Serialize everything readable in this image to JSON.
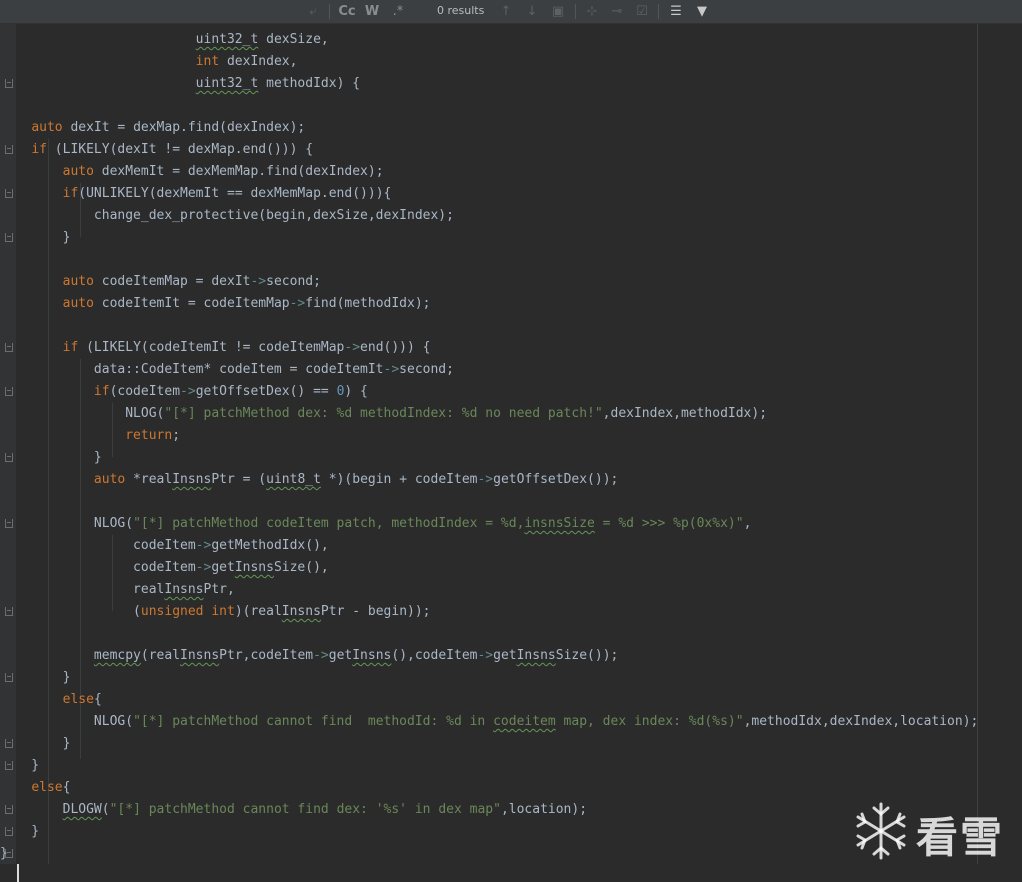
{
  "find_bar": {
    "results_label": "0 results",
    "match_case_label": "Cc",
    "words_label": "W",
    "regex_label": ".*"
  },
  "code_lines": [
    [
      {
        "t": "                         "
      },
      {
        "t": "uint32_t",
        "c": "uw"
      },
      {
        "t": " dexSize,"
      }
    ],
    [
      {
        "t": "                         "
      },
      {
        "t": "int",
        "c": "kw"
      },
      {
        "t": " dexIndex,"
      }
    ],
    [
      {
        "t": "                         "
      },
      {
        "t": "uint32_t",
        "c": "uw"
      },
      {
        "t": " methodIdx) {"
      }
    ],
    [],
    [
      {
        "t": "    "
      },
      {
        "t": "auto",
        "c": "kw"
      },
      {
        "t": " dexIt = dexMap.find(dexIndex);"
      }
    ],
    [
      {
        "t": "    "
      },
      {
        "t": "if",
        "c": "kw"
      },
      {
        "t": " (LIKELY(dexIt != dexMap.end())) {"
      }
    ],
    [
      {
        "t": "        "
      },
      {
        "t": "auto",
        "c": "kw"
      },
      {
        "t": " dexMemIt = dexMemMap.find(dexIndex);"
      }
    ],
    [
      {
        "t": "        "
      },
      {
        "t": "if",
        "c": "kw"
      },
      {
        "t": "(UNLIKELY(dexMemIt == dexMemMap.end())){"
      }
    ],
    [
      {
        "t": "            change_dex_protective(begin,dexSize,dexIndex);"
      }
    ],
    [
      {
        "t": "        }"
      }
    ],
    [],
    [
      {
        "t": "        "
      },
      {
        "t": "auto",
        "c": "kw"
      },
      {
        "t": " codeItemMap = dexIt"
      },
      {
        "t": "->",
        "c": "arr"
      },
      {
        "t": "second;"
      }
    ],
    [
      {
        "t": "        "
      },
      {
        "t": "auto",
        "c": "kw"
      },
      {
        "t": " codeItemIt = codeItemMap"
      },
      {
        "t": "->",
        "c": "arr"
      },
      {
        "t": "find(methodIdx);"
      }
    ],
    [],
    [
      {
        "t": "        "
      },
      {
        "t": "if",
        "c": "kw"
      },
      {
        "t": " (LIKELY(codeItemIt != codeItemMap"
      },
      {
        "t": "->",
        "c": "arr"
      },
      {
        "t": "end())) {"
      }
    ],
    [
      {
        "t": "            data::CodeItem* codeItem = codeItemIt"
      },
      {
        "t": "->",
        "c": "arr"
      },
      {
        "t": "second;"
      }
    ],
    [
      {
        "t": "            "
      },
      {
        "t": "if",
        "c": "kw"
      },
      {
        "t": "(codeItem"
      },
      {
        "t": "->",
        "c": "arr"
      },
      {
        "t": "getOffsetDex() == "
      },
      {
        "t": "0",
        "c": "num"
      },
      {
        "t": ") {"
      }
    ],
    [
      {
        "t": "                NLOG("
      },
      {
        "t": "\"[*] patchMethod dex: %d methodIndex: %d no need patch!\"",
        "c": "str"
      },
      {
        "t": ",dexIndex,methodIdx);"
      }
    ],
    [
      {
        "t": "                "
      },
      {
        "t": "return",
        "c": "kw"
      },
      {
        "t": ";"
      }
    ],
    [
      {
        "t": "            }"
      }
    ],
    [
      {
        "t": "            "
      },
      {
        "t": "auto",
        "c": "kw"
      },
      {
        "t": " *real"
      },
      {
        "t": "Insns",
        "c": "uw"
      },
      {
        "t": "Ptr = ("
      },
      {
        "t": "uint8_t",
        "c": "uw"
      },
      {
        "t": " *)(begin + codeItem"
      },
      {
        "t": "->",
        "c": "arr"
      },
      {
        "t": "getOffsetDex());"
      }
    ],
    [],
    [
      {
        "t": "            NLOG("
      },
      {
        "t": "\"[*] patchMethod codeItem patch, methodIndex = %d,",
        "c": "str"
      },
      {
        "t": "insnsSize",
        "c": "str uw"
      },
      {
        "t": " = %d >>> %p(0x%x)\"",
        "c": "str"
      },
      {
        "t": ","
      }
    ],
    [
      {
        "t": "                 codeItem"
      },
      {
        "t": "->",
        "c": "arr"
      },
      {
        "t": "getMethodIdx(),"
      }
    ],
    [
      {
        "t": "                 codeItem"
      },
      {
        "t": "->",
        "c": "arr"
      },
      {
        "t": "get"
      },
      {
        "t": "Insns",
        "c": "uw"
      },
      {
        "t": "Size(),"
      }
    ],
    [
      {
        "t": "                 real"
      },
      {
        "t": "Insns",
        "c": "uw"
      },
      {
        "t": "Ptr,"
      }
    ],
    [
      {
        "t": "                 ("
      },
      {
        "t": "unsigned int",
        "c": "kw"
      },
      {
        "t": ")(real"
      },
      {
        "t": "Insns",
        "c": "uw"
      },
      {
        "t": "Ptr - begin));"
      }
    ],
    [],
    [
      {
        "t": "            "
      },
      {
        "t": "memcpy",
        "c": "uw"
      },
      {
        "t": "(real"
      },
      {
        "t": "Insns",
        "c": "uw"
      },
      {
        "t": "Ptr,codeItem"
      },
      {
        "t": "->",
        "c": "arr"
      },
      {
        "t": "get"
      },
      {
        "t": "Insns",
        "c": "uw"
      },
      {
        "t": "(),codeItem"
      },
      {
        "t": "->",
        "c": "arr"
      },
      {
        "t": "get"
      },
      {
        "t": "Insns",
        "c": "uw"
      },
      {
        "t": "Size());"
      }
    ],
    [
      {
        "t": "        }"
      }
    ],
    [
      {
        "t": "        "
      },
      {
        "t": "else",
        "c": "kw"
      },
      {
        "t": "{"
      }
    ],
    [
      {
        "t": "            NLOG("
      },
      {
        "t": "\"[*] patchMethod cannot find  methodId: %d in ",
        "c": "str"
      },
      {
        "t": "codeitem",
        "c": "str uw"
      },
      {
        "t": " map, dex index: %d(%s)\"",
        "c": "str"
      },
      {
        "t": ",methodIdx,dexIndex,location);"
      }
    ],
    [
      {
        "t": "        }"
      }
    ],
    [
      {
        "t": "    }"
      }
    ],
    [
      {
        "t": "    "
      },
      {
        "t": "else",
        "c": "kw"
      },
      {
        "t": "{"
      }
    ],
    [
      {
        "t": "        "
      },
      {
        "t": "DLOGW",
        "c": "uw"
      },
      {
        "t": "("
      },
      {
        "t": "\"[*] patchMethod cannot find dex: '%s' in dex map\"",
        "c": "str"
      },
      {
        "t": ",location);"
      }
    ],
    [
      {
        "t": "    }"
      }
    ],
    [
      {
        "t": "}"
      }
    ]
  ],
  "fold_marker_lines": [
    2,
    5,
    7,
    9,
    14,
    16,
    19,
    22,
    26,
    29,
    32,
    33,
    35,
    36,
    37
  ],
  "watermark": {
    "text": "看雪",
    "icon": "snowflake-icon"
  }
}
